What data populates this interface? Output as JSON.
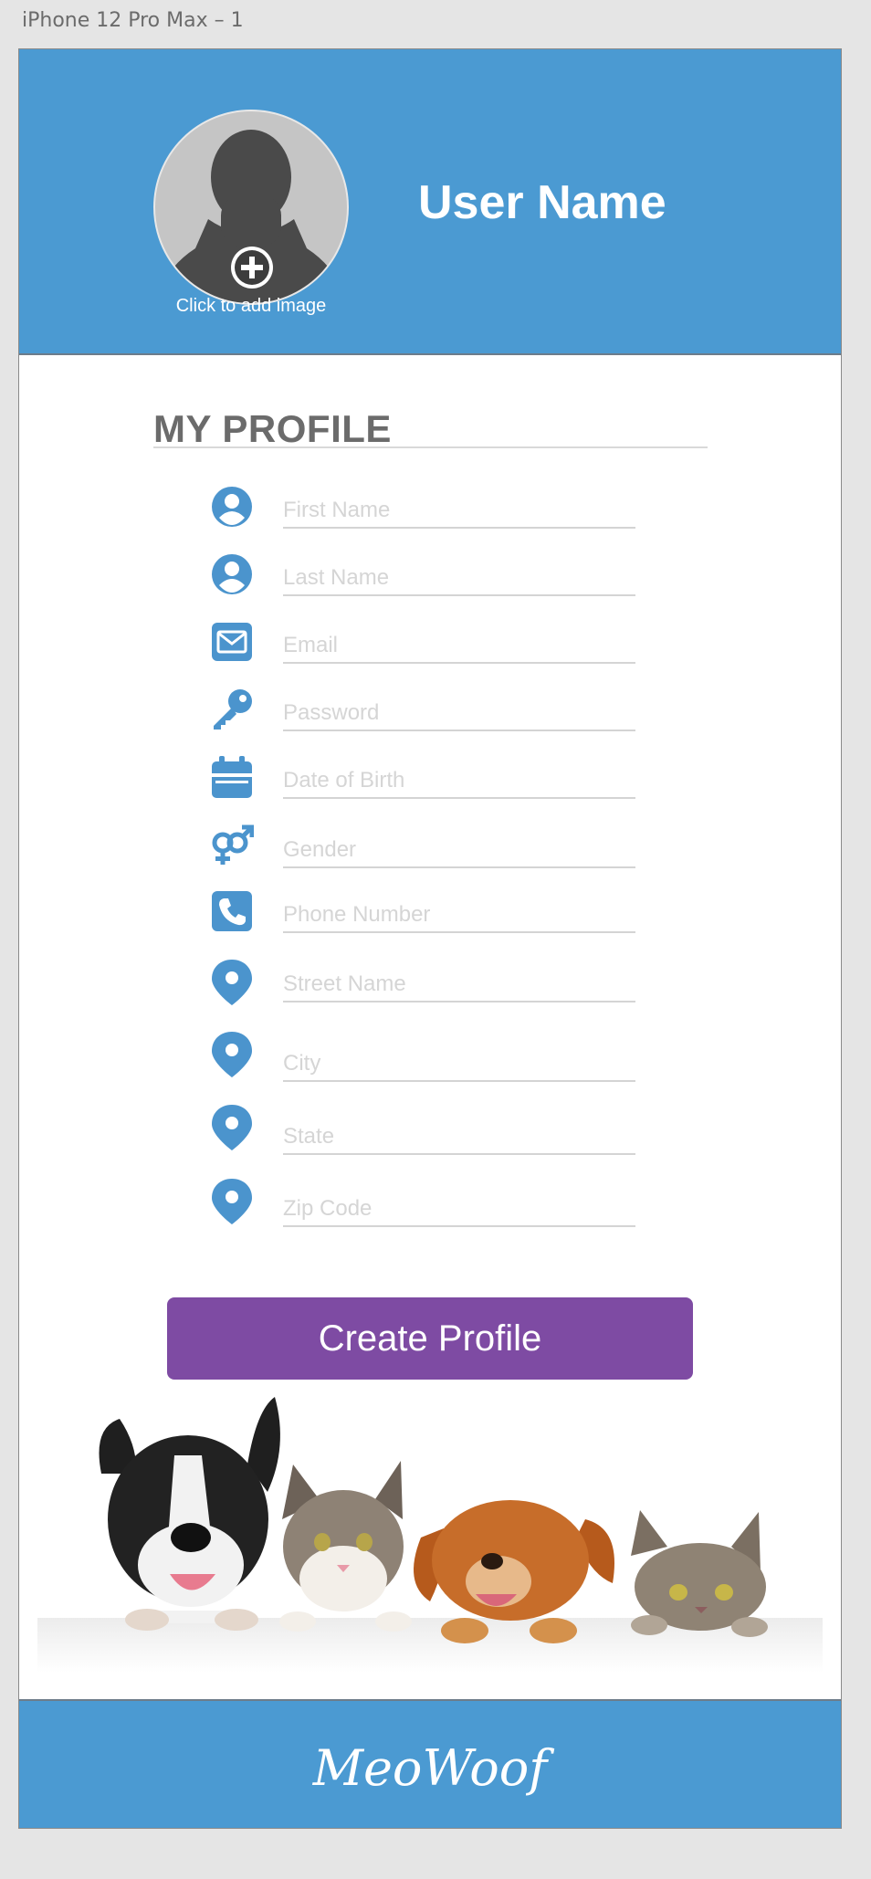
{
  "artboard": {
    "title": "iPhone 12 Pro Max – 1"
  },
  "header": {
    "user_name": "User Name",
    "avatar_caption": "Click to add image"
  },
  "profile": {
    "section_title": "MY PROFILE",
    "fields": [
      {
        "icon": "user-circle-icon",
        "placeholder": "First Name",
        "value": ""
      },
      {
        "icon": "user-circle-icon",
        "placeholder": "Last Name",
        "value": ""
      },
      {
        "icon": "envelope-icon",
        "placeholder": "Email",
        "value": ""
      },
      {
        "icon": "key-icon",
        "placeholder": "Password",
        "value": ""
      },
      {
        "icon": "calendar-icon",
        "placeholder": "Date of Birth",
        "value": ""
      },
      {
        "icon": "gender-icon",
        "placeholder": "Gender",
        "value": ""
      },
      {
        "icon": "phone-icon",
        "placeholder": "Phone Number",
        "value": ""
      },
      {
        "icon": "map-pin-icon",
        "placeholder": "Street Name",
        "value": ""
      },
      {
        "icon": "map-pin-icon",
        "placeholder": "City",
        "value": ""
      },
      {
        "icon": "map-pin-icon",
        "placeholder": "State",
        "value": ""
      },
      {
        "icon": "map-pin-icon",
        "placeholder": "Zip Code",
        "value": ""
      }
    ],
    "submit_label": "Create Profile"
  },
  "footer": {
    "brand": "MeoWoof"
  },
  "colors": {
    "header_blue": "#4b9ad2",
    "icon_blue": "#4b94cd",
    "button_purple": "#7e4ba3",
    "heading_gray": "#6b6b6b",
    "placeholder_gray": "#d5d5d5"
  }
}
